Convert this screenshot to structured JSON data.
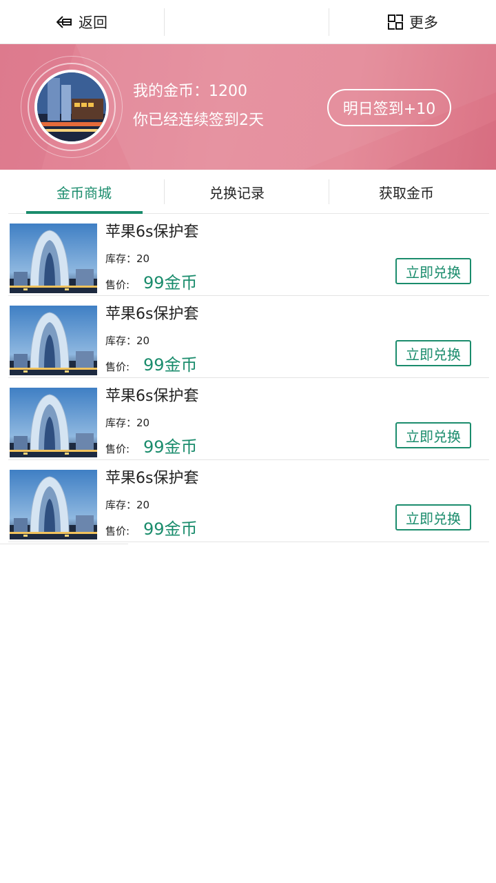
{
  "topbar": {
    "back_label": "返回",
    "back_icon": "arrow-left-icon",
    "more_label": "更多",
    "more_icon": "grid-icon"
  },
  "banner": {
    "coins_text": "我的金币：1200",
    "days_text": "你已经连续签到2天",
    "sign_button": "明日签到+10",
    "avatar_icon": "avatar-building-image"
  },
  "tabs": [
    {
      "label": "金币商城",
      "active": true
    },
    {
      "label": "兑换记录",
      "active": false
    },
    {
      "label": "获取金币",
      "active": false
    }
  ],
  "products": [
    {
      "name": "苹果6s保护套",
      "stock": "库存：20",
      "price_label": "售价:",
      "price": "99金币",
      "button": "立即兑换"
    },
    {
      "name": "苹果6s保护套",
      "stock": "库存：20",
      "price_label": "售价:",
      "price": "99金币",
      "button": "立即兑换"
    },
    {
      "name": "苹果6s保护套",
      "stock": "库存：20",
      "price_label": "售价:",
      "price": "99金币",
      "button": "立即兑换"
    },
    {
      "name": "苹果6s保护套",
      "stock": "库存：20",
      "price_label": "售价:",
      "price": "99金币",
      "button": "立即兑换"
    }
  ],
  "colors": {
    "accent": "#1a8c6c",
    "banner": "#e58d9c"
  }
}
